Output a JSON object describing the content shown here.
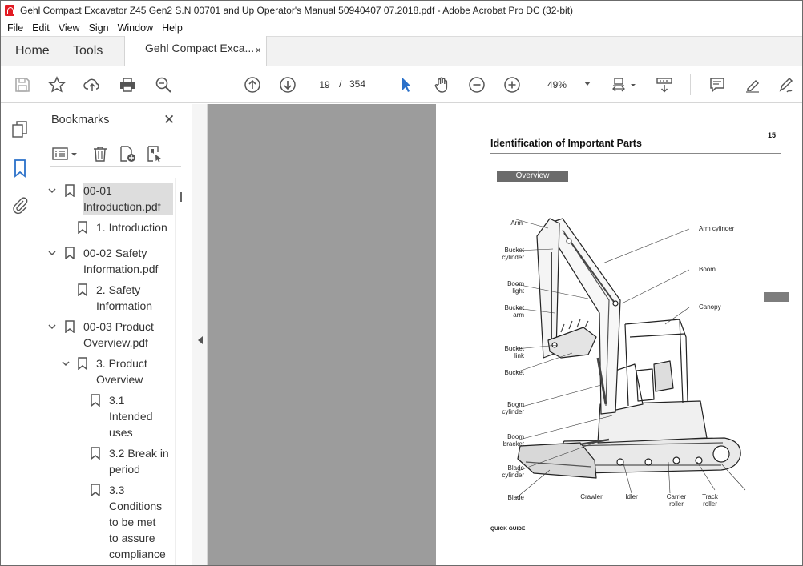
{
  "window": {
    "title": "Gehl Compact Excavator Z45 Gen2 S.N 00701 and Up Operator's Manual 50940407 07.2018.pdf - Adobe Acrobat Pro DC (32-bit)"
  },
  "menu": [
    "File",
    "Edit",
    "View",
    "Sign",
    "Window",
    "Help"
  ],
  "tabs": {
    "home": "Home",
    "tools": "Tools",
    "document": "Gehl Compact Exca...",
    "close": "×"
  },
  "toolbar": {
    "current_page": "19",
    "page_separator": "/",
    "total_pages": "354",
    "zoom": "49%"
  },
  "bookmarks": {
    "title": "Bookmarks",
    "close": "✕",
    "items": [
      {
        "line1": "00-01",
        "line2": "Introduction.pdf"
      },
      {
        "line1": "1. Introduction"
      },
      {
        "line1": "00-02 Safety",
        "line2": "Information.pdf"
      },
      {
        "line1": "2. Safety",
        "line2": "Information"
      },
      {
        "line1": "00-03 Product",
        "line2": "Overview.pdf"
      },
      {
        "line1": "3. Product",
        "line2": "Overview"
      },
      {
        "line1": "3.1",
        "line2": "Intended",
        "line3": "uses"
      },
      {
        "line1": "3.2 Break in",
        "line2": "period"
      },
      {
        "line1": "3.3",
        "line2": "Conditions",
        "line3": "to be met",
        "line4": "to assure",
        "line5": "compliance"
      }
    ]
  },
  "document": {
    "page_number": "15",
    "heading": "Identification of Important Parts",
    "section_badge": "Overview",
    "footer": "QUICK GUIDE",
    "labels": {
      "arm": "Arm",
      "bucket_cylinder": [
        "Bucket",
        "cylinder"
      ],
      "boom_light": [
        "Boom",
        "light"
      ],
      "bucket_arm": [
        "Bucket",
        "arm"
      ],
      "bucket_link": [
        "Bucket",
        "link"
      ],
      "bucket": "Bucket",
      "boom_cylinder": [
        "Boom",
        "cylinder"
      ],
      "boom_bracket": [
        "Boom",
        "bracket"
      ],
      "blade_cylinder": [
        "Blade",
        "cylinder"
      ],
      "blade": "Blade",
      "arm_cylinder": "Arm cylinder",
      "boom": "Boom",
      "canopy": "Canopy",
      "crawler": "Crawler",
      "idler": "Idler",
      "carrier_roller": [
        "Carrier",
        "roller"
      ],
      "track_roller": [
        "Track",
        "roller"
      ]
    }
  }
}
